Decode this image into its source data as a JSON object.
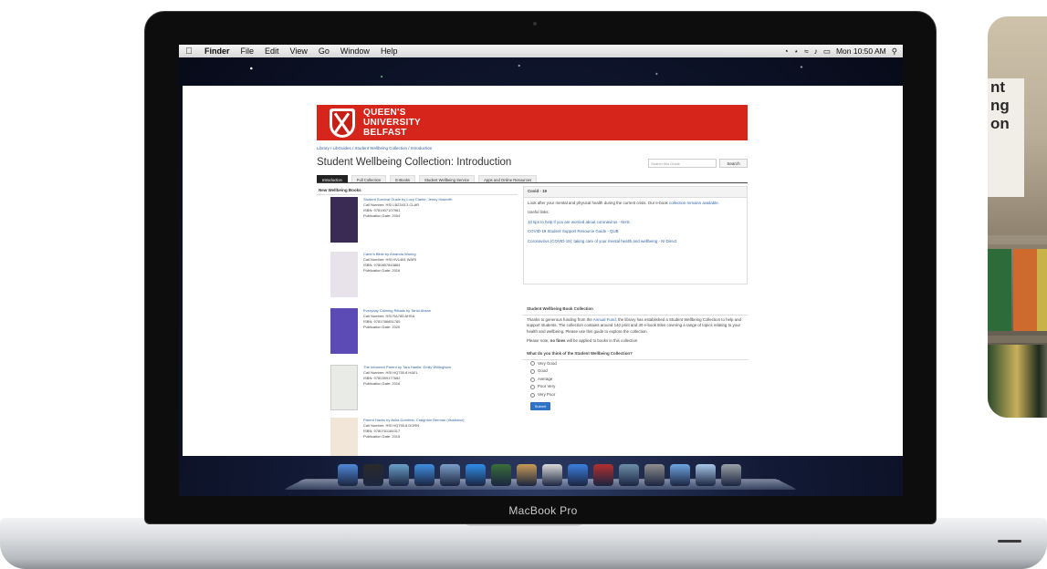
{
  "device": {
    "label": "MacBook Pro"
  },
  "menubar": {
    "app": "Finder",
    "items": [
      "File",
      "Edit",
      "View",
      "Go",
      "Window",
      "Help"
    ],
    "clock": "Mon 10:50 AM"
  },
  "site": {
    "university_lines": [
      "QUEEN'S",
      "UNIVERSITY",
      "BELFAST"
    ],
    "breadcrumb": "Library / LibGuides / Student Wellbeing Collection / Introduction",
    "title": "Student Wellbeing Collection: Introduction",
    "search_placeholder": "Search this Guide",
    "search_button": "Search",
    "tabs": [
      "Introduction",
      "Full Collection",
      "E-Books",
      "Student Wellbeing Service",
      "Apps and Online Resources"
    ]
  },
  "new_books": {
    "heading": "New Wellbeing Books",
    "items": [
      {
        "title": "Student Survival Guide",
        "author": "by Lucy Clarke, Jenny Haworth",
        "call": "Call Number: HSI LB2343.3 CLAR",
        "isbn": "ISBN: 9781907107961",
        "date": "Publication Date: 2004",
        "cover": "#3a2b55"
      },
      {
        "title": "Carer's Bible",
        "author": "by Amanda Waring",
        "call": "Call Number: HSI HV1481 WARI",
        "isbn": "ISBN: 9780857843864",
        "date": "Publication Date: 2016",
        "cover": "#e8e2ea"
      },
      {
        "title": "Everyday Calming Rituals",
        "author": "by Tania Ahsan",
        "call": "Call Number: HSI RA785 AHSA",
        "isbn": "ISBN: 9781786851765",
        "date": "Publication Date: 2020",
        "cover": "#5d4bb5"
      },
      {
        "title": "The Informed Parent",
        "author": "by Tara Haelle, Emily Willingham",
        "call": "Call Number: HSI HQ755.8 HAEL",
        "isbn": "ISBN: 9780399177682",
        "date": "Publication Date: 2016",
        "cover": "#e9ebe6"
      },
      {
        "title": "Parent Hacks",
        "author": "by Asha Dornfest, Craighton Berman (Illustrator)",
        "call": "Call Number: HSI HQ755.8 DORN",
        "isbn": "ISBN: 9780761184317",
        "date": "Publication Date: 2015",
        "cover": "#f1e6d7"
      }
    ]
  },
  "covid": {
    "heading": "Covid - 19",
    "intro": "Look after your mental and physical health during the current crisis. Our e-book",
    "intro_link": "collection remains available.",
    "useful": "Useful links:",
    "links": [
      "10 tips to help if you are worried about coronavirus - NHS",
      "COVID-19 Student Support Resource Guide - QUB",
      "Coronavirus (COVID-19): taking care of your mental health and wellbeing - NI Direct"
    ]
  },
  "collection": {
    "heading": "Student Wellbeing Book Collection",
    "body_pre": "Thanks to generous funding from the",
    "body_link": "Annual Fund,",
    "body_post": "the library has established a Student Wellbeing Collection to help and support students. The collection contains around 140 print and 30 e-book titles covering a range of topics relating to your health and wellbeing. Please use this guide to explore the collection.",
    "note_pre": "Please note,",
    "note_bold": "no fines",
    "note_post": "will be applied to books in this collection"
  },
  "poll": {
    "question": "What do you think of the Student Wellbeing Collection?",
    "options": [
      "Very Good",
      "Good",
      "Average",
      "Poor Very",
      "Very Poor"
    ],
    "submit": "Submit"
  },
  "photo_sign": [
    "nt",
    "ng",
    "on"
  ],
  "dock_icons": [
    "finder-icon",
    "dashboard-icon",
    "mission-control-icon",
    "app-store-icon",
    "preview-icon",
    "safari-icon",
    "facetime-icon",
    "ical-icon",
    "calendar-icon",
    "itunes-icon",
    "photo-booth-icon",
    "iphoto-icon",
    "system-prefs-icon",
    "applications-folder-icon",
    "documents-folder-icon",
    "trash-icon"
  ]
}
